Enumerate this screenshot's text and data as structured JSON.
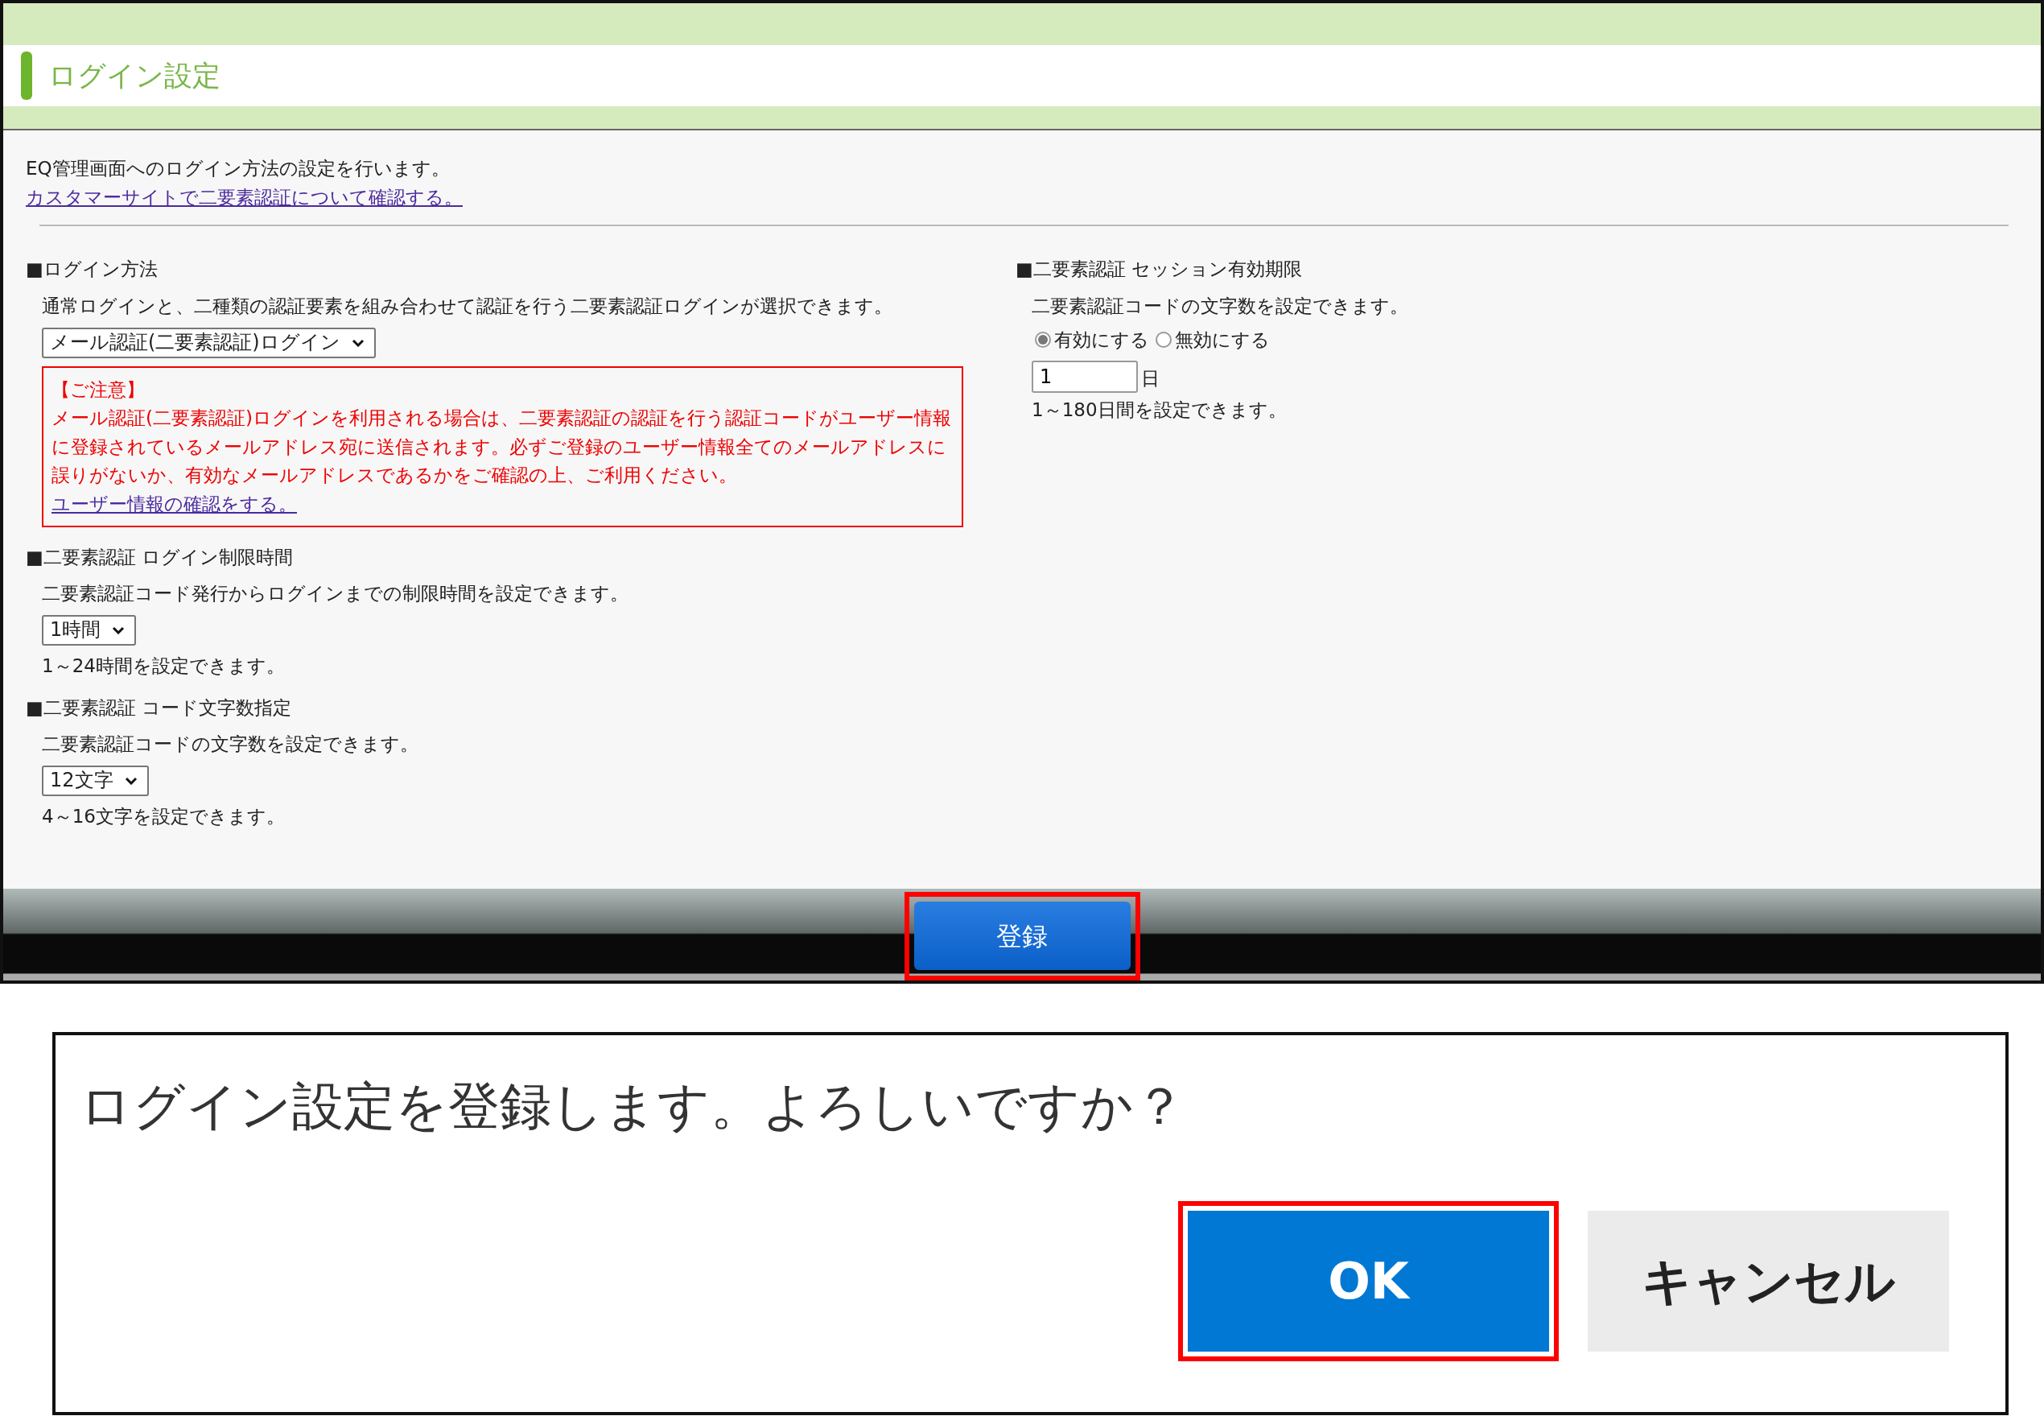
{
  "header": {
    "title": "ログイン設定"
  },
  "intro": {
    "text": "EQ管理画面へのログイン方法の設定を行います。",
    "link": "カスタマーサイトで二要素認証について確認する。"
  },
  "left_sections": [
    {
      "heading": "■ログイン方法",
      "description": "通常ログインと、二種類の認証要素を組み合わせて認証を行う二要素認証ログインが選択できます。",
      "controls": [
        {
          "kind": "select",
          "value": "メール認証(二要素認証)ログイン"
        },
        {
          "kind": "notice",
          "title": "【ご注意】",
          "text": "メール認証(二要素認証)ログインを利用される場合は、二要素認証の認証を行う認証コードがユーザー情報に登録されているメールアドレス宛に送信されます。必ずご登録のユーザー情報全てのメールアドレスに誤りがないか、有効なメールアドレスであるかをご確認の上、ご利用ください。",
          "link": "ユーザー情報の確認をする。"
        }
      ]
    },
    {
      "heading": "■二要素認証 ログイン制限時間",
      "description": "二要素認証コード発行からログインまでの制限時間を設定できます。",
      "controls": [
        {
          "kind": "select",
          "value": "1時間"
        },
        {
          "kind": "hint",
          "text": "1～24時間を設定できます。"
        }
      ]
    },
    {
      "heading": "■二要素認証 コード文字数指定",
      "description": "二要素認証コードの文字数を設定できます。",
      "controls": [
        {
          "kind": "select",
          "value": "12文字"
        },
        {
          "kind": "hint",
          "text": "4～16文字を設定できます。"
        }
      ]
    }
  ],
  "right_sections": [
    {
      "heading": "■二要素認証 セッション有効期限",
      "description": "二要素認証コードの文字数を設定できます。",
      "controls": [
        {
          "kind": "radios",
          "options": [
            {
              "label": "有効にする",
              "selected": true
            },
            {
              "label": "無効にする",
              "selected": false
            }
          ]
        },
        {
          "kind": "number",
          "value": "1",
          "unit": "日"
        },
        {
          "kind": "hint",
          "text": "1～180日間を設定できます。"
        }
      ]
    }
  ],
  "footer": {
    "submit_button": "登録",
    "highlighted": true
  },
  "dialog": {
    "message": "ログイン設定を登録します。よろしいですか？",
    "buttons": [
      {
        "label": "OK",
        "primary": true,
        "highlighted": true
      },
      {
        "label": "キャンセル",
        "primary": false,
        "highlighted": false
      }
    ]
  }
}
